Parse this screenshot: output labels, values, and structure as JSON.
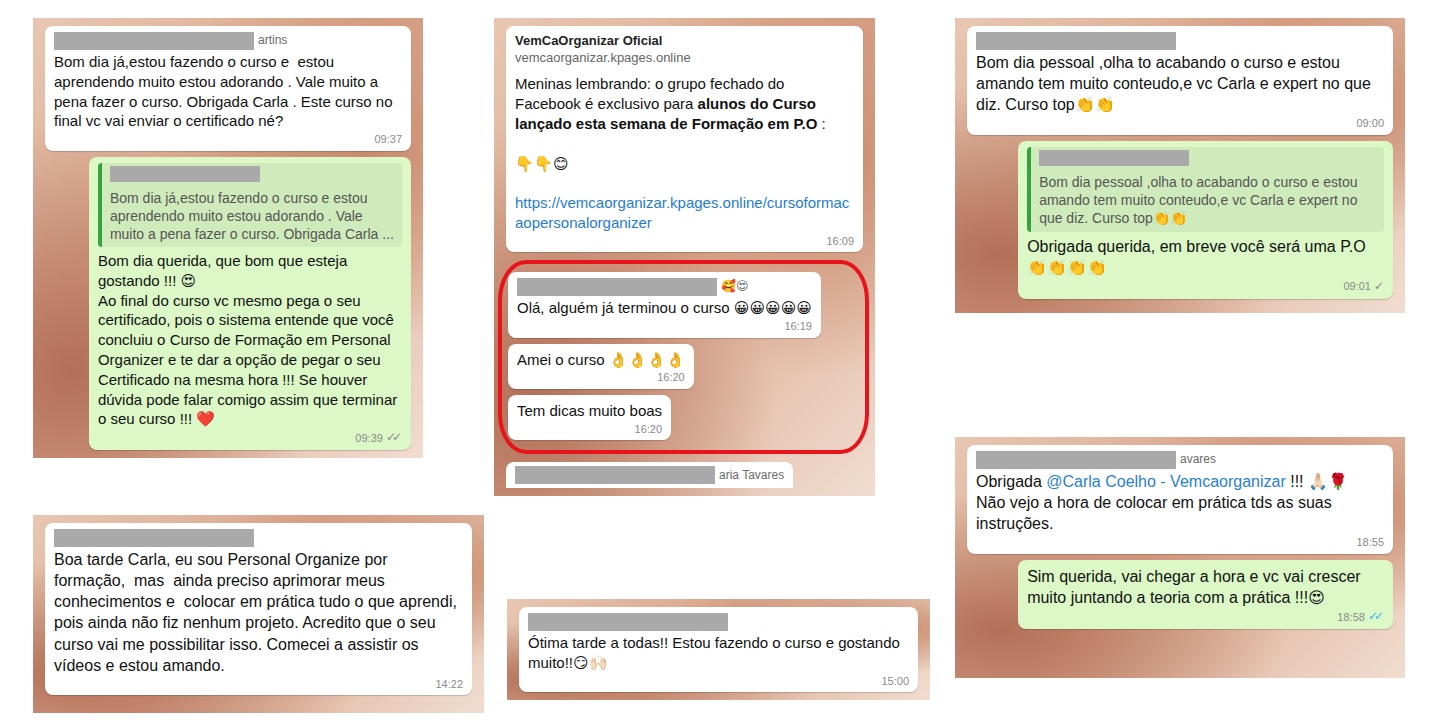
{
  "columns": [
    {
      "panels": [
        {
          "groups": [
            {
              "highlighted": false,
              "messages": [
                {
                  "kind": "incoming",
                  "sender": {
                    "redacted": true,
                    "tail": "artins"
                  },
                  "segments": [
                    {
                      "kind": "plain",
                      "text": "Bom dia já,estou fazendo o curso e  estou aprendendo muito estou adorando . Vale muito a pena fazer o curso. Obrigada Carla . Este curso no final vc vai enviar o certificado né?"
                    }
                  ],
                  "time": "09:37"
                },
                {
                  "kind": "outgoing",
                  "quote": {
                    "author_redacted": true,
                    "text": "Bom dia já,estou fazendo o curso e  estou aprendendo muito estou adorando . Vale muito a pena fazer o curso. Obrigada Carla ..."
                  },
                  "segments": [
                    {
                      "kind": "plain",
                      "text": "Bom dia querida, que bom que esteja gostando !!! 😍\nAo final do curso vc mesmo pega o seu certificado, pois o sistema entende que você concluiu o Curso de Formação em Personal Organizer e te dar a opção de pegar o seu Certificado na mesma hora !!! Se houver dúvida pode falar comigo assim que terminar o seu curso !!! ❤️"
                    }
                  ],
                  "time": "09:39",
                  "ticks": "✓✓",
                  "read": false
                }
              ]
            }
          ]
        },
        {
          "groups": [
            {
              "highlighted": false,
              "messages": [
                {
                  "kind": "incoming",
                  "sender": {
                    "redacted": true
                  },
                  "segments": [
                    {
                      "kind": "plain",
                      "text": "Boa tarde Carla, eu sou Personal Organize por formação,  mas  ainda preciso aprimorar meus conhecimentos e  colocar em prática tudo o que aprendi, pois ainda não fiz nenhum projeto. Acredito que o seu curso vai me possibilitar isso. Comecei a assistir os vídeos e estou amando."
                    }
                  ],
                  "time": "14:22"
                }
              ]
            }
          ]
        }
      ]
    },
    {
      "panels": [
        {
          "groups": [
            {
              "highlighted": false,
              "messages": [
                {
                  "kind": "channel",
                  "header": {
                    "title": "VemCaOrganizar Oficial",
                    "site": "vemcaorganizar.kpages.online"
                  },
                  "segments": [
                    {
                      "kind": "plain",
                      "text": "Meninas lembrando: o grupo fechado do Facebook é exclusivo para "
                    },
                    {
                      "kind": "bold",
                      "text": "alunos do Curso lançado esta semana de Formação em P.O"
                    },
                    {
                      "kind": "plain",
                      "text": " :\n\n👇👇😊\n\n"
                    },
                    {
                      "kind": "link",
                      "text": "https://vemcaorganizar.kpages.online/cursoformacaopersonalorganizer"
                    }
                  ],
                  "time": "16:09"
                }
              ]
            },
            {
              "highlighted": true,
              "messages": [
                {
                  "kind": "incoming",
                  "sender": {
                    "redacted": true,
                    "tail": "🥰😍"
                  },
                  "segments": [
                    {
                      "kind": "plain",
                      "text": "Olá, alguém já terminou o curso 😀😀😀😀😀"
                    }
                  ],
                  "time": "16:19"
                },
                {
                  "kind": "incoming",
                  "segments": [
                    {
                      "kind": "plain",
                      "text": "Amei o curso 👌👌👌👌"
                    }
                  ],
                  "time": "16:20"
                },
                {
                  "kind": "incoming",
                  "segments": [
                    {
                      "kind": "plain",
                      "text": "Tem dicas muito boas"
                    }
                  ],
                  "time": "16:20"
                }
              ]
            }
          ],
          "footer": {
            "redacted": true,
            "tail": "aria Tavares"
          }
        },
        {
          "groups": [
            {
              "highlighted": false,
              "messages": [
                {
                  "kind": "incoming",
                  "sender": {
                    "redacted": true
                  },
                  "segments": [
                    {
                      "kind": "plain",
                      "text": "Ótima tarde a todas!! Estou fazendo o curso e gostando muito!!😏🙌🏻"
                    }
                  ],
                  "time": "15:00"
                }
              ]
            }
          ]
        }
      ]
    },
    {
      "panels": [
        {
          "groups": [
            {
              "highlighted": false,
              "messages": [
                {
                  "kind": "incoming",
                  "sender": {
                    "redacted": true
                  },
                  "segments": [
                    {
                      "kind": "plain",
                      "text": "Bom dia pessoal ,olha to acabando o curso e estou amando tem muito conteudo,e vc Carla e expert no que diz. Curso top👏👏"
                    }
                  ],
                  "time": "09:00"
                },
                {
                  "kind": "outgoing",
                  "quote": {
                    "author_redacted": true,
                    "text": "Bom dia pessoal ,olha to acabando o curso e estou amando tem muito conteudo,e vc Carla e expert no que diz. Curso top👏👏"
                  },
                  "segments": [
                    {
                      "kind": "plain",
                      "text": "Obrigada querida, em breve você será uma P.O 👏👏👏👏"
                    }
                  ],
                  "time": "09:01",
                  "ticks": "✓",
                  "read": false
                }
              ]
            }
          ]
        },
        {
          "groups": [
            {
              "highlighted": false,
              "messages": [
                {
                  "kind": "incoming",
                  "sender": {
                    "redacted": true,
                    "tail": "avares"
                  },
                  "segments": [
                    {
                      "kind": "plain",
                      "text": "Obrigada "
                    },
                    {
                      "kind": "mention",
                      "text": "@Carla Coelho - Vemcaorganizar"
                    },
                    {
                      "kind": "plain",
                      "text": " !!! 🙏🏻🌹\nNão vejo a hora de colocar em prática tds as suas instruções."
                    }
                  ],
                  "time": "18:55"
                },
                {
                  "kind": "outgoing",
                  "segments": [
                    {
                      "kind": "plain",
                      "text": "Sim querida, vai chegar a hora e vc vai crescer muito juntando a teoria com a prática !!!😍"
                    }
                  ],
                  "time": "18:58",
                  "ticks": "✓✓",
                  "read": true
                }
              ]
            }
          ]
        }
      ]
    }
  ]
}
